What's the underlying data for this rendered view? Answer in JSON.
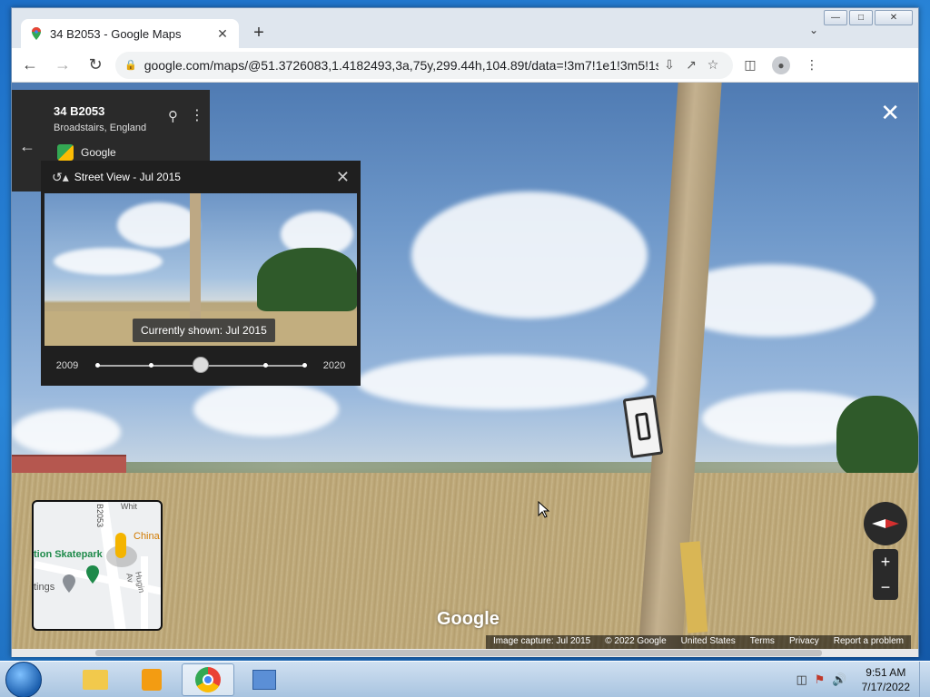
{
  "browser": {
    "tab_title": "34 B2053 - Google Maps",
    "url": "google.com/maps/@51.3726083,1.4182493,3a,75y,299.44h,104.89t/data=!3m7!1e1!3m5!1sMzVKbzmn...",
    "icons": {
      "back": "back-arrow-icon",
      "forward": "forward-arrow-icon",
      "reload": "reload-icon",
      "lock": "lock-icon",
      "install": "install-icon",
      "share": "share-icon",
      "bookmark": "star-icon",
      "sidepanel": "side-panel-icon",
      "profile": "profile-icon",
      "menu": "kebab-menu-icon"
    }
  },
  "place": {
    "title": "34 B2053",
    "subtitle": "Broadstairs, England",
    "source": "Google"
  },
  "time_travel": {
    "header": "Street View - Jul 2015",
    "tooltip": "Currently shown: Jul 2015",
    "start_year": "2009",
    "end_year": "2020",
    "selected_index": 2,
    "total_stops": 5
  },
  "minimap": {
    "road_label_vertical": "B2053",
    "road_label_top": "Whit",
    "poi_skatepark": "tion Skatepark",
    "poi_china": "China",
    "poi_tings": "tings",
    "road_hugin": "Hugin Av"
  },
  "watermark": "Google",
  "footer": {
    "capture": "Image capture: Jul 2015",
    "copyright": "© 2022 Google",
    "region": "United States",
    "terms": "Terms",
    "privacy": "Privacy",
    "report": "Report a problem"
  },
  "taskbar": {
    "time": "9:51 AM",
    "date": "7/17/2022"
  }
}
